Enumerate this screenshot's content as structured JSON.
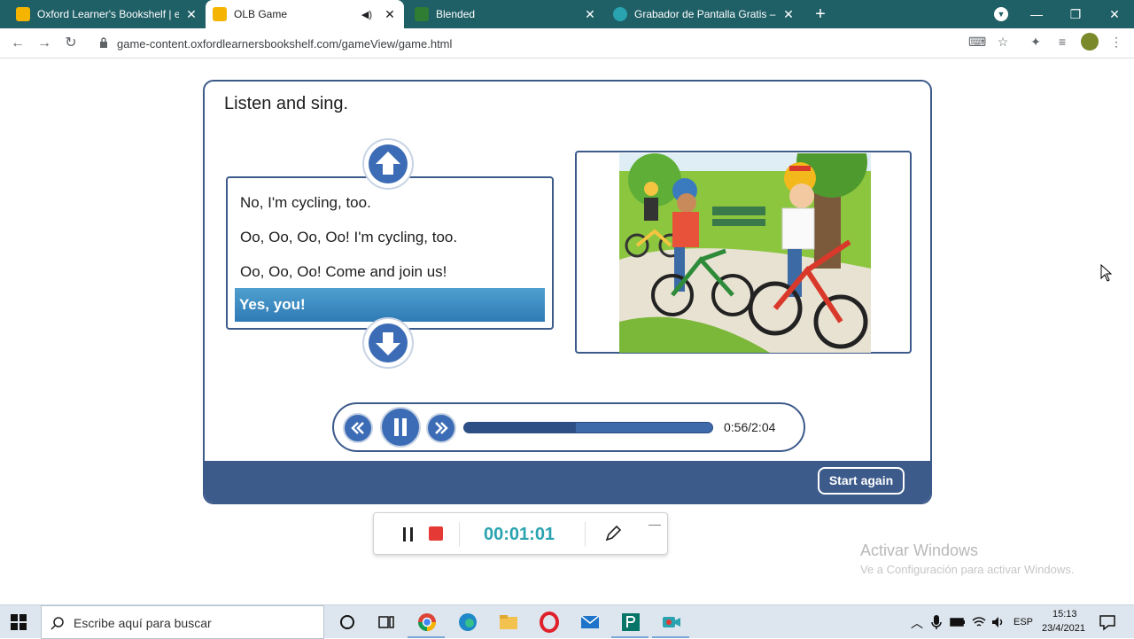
{
  "browser": {
    "tabs": [
      {
        "title": "Oxford Learner's Bookshelf | e-bo",
        "favicon_color": "#f5b400",
        "active": false
      },
      {
        "title": "OLB Game",
        "favicon_color": "#f5b400",
        "active": true
      },
      {
        "title": "Blended",
        "favicon_color": "#2e7d32",
        "active": false
      },
      {
        "title": "Grabador de Pantalla Gratis – Cap",
        "favicon_color": "#2aa3b0",
        "active": false
      }
    ],
    "url": "game-content.oxfordlearnersbookshelf.com/gameView/game.html"
  },
  "game": {
    "title": "Listen and sing.",
    "lyrics": [
      "No, I'm cycling, too.",
      "Oo, Oo, Oo, Oo! I'm cycling, too.",
      "Oo, Oo, Oo! Come and join us!",
      "Yes, you!"
    ],
    "highlighted_index": 3,
    "player": {
      "time": "0:56/2:04",
      "progress_fraction": 0.45
    },
    "start_again_label": "Start again"
  },
  "recorder": {
    "elapsed": "00:01:01"
  },
  "watermark": {
    "line1": "Activar Windows",
    "line2": "Ve a Configuración para activar Windows."
  },
  "taskbar": {
    "search_placeholder": "Escribe aquí para buscar",
    "language": "ESP",
    "time": "15:13",
    "date": "23/4/2021"
  },
  "colors": {
    "chrome_tabbar": "#1f5f66",
    "game_accent": "#3c5a8a",
    "button_blue": "#3c6cb5",
    "highlight": "#3d8cc5",
    "recorder_time": "#2aa3b0",
    "record_red": "#e53935"
  }
}
